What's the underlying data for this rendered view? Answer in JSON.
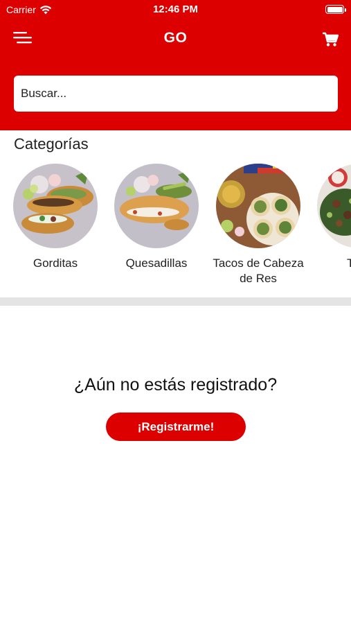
{
  "status_bar": {
    "carrier": "Carrier",
    "time": "12:46 PM"
  },
  "nav": {
    "title": "GO",
    "menu_icon": "hamburger-menu-icon",
    "cart_icon": "shopping-cart-icon"
  },
  "search": {
    "placeholder": "Buscar..."
  },
  "categories": {
    "title": "Categorías",
    "items": [
      {
        "label": "Gorditas"
      },
      {
        "label": "Quesadillas"
      },
      {
        "label": "Tacos de Cabeza de Res"
      },
      {
        "label": "Taco"
      }
    ]
  },
  "register": {
    "question": "¿Aún no estás registrado?",
    "button_label": "¡Registrarme!"
  },
  "colors": {
    "brand_red": "#dd0000",
    "divider_gray": "#e4e4e4"
  }
}
